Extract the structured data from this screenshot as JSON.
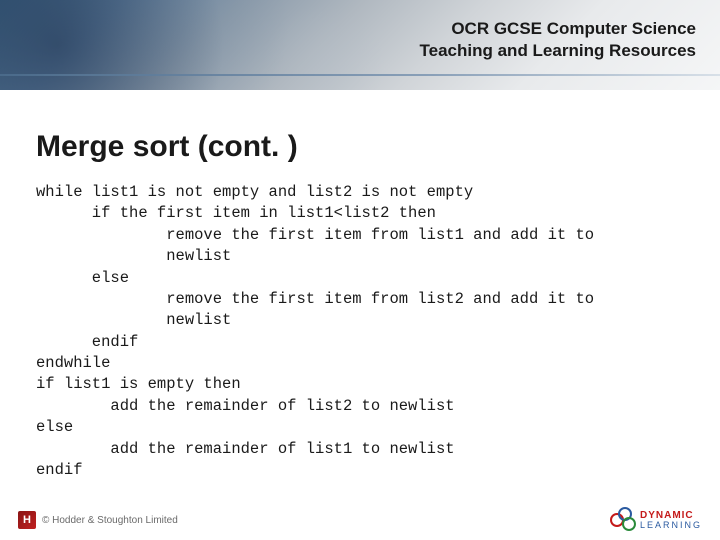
{
  "header": {
    "line1": "OCR GCSE Computer Science",
    "line2": "Teaching and Learning Resources"
  },
  "title": "Merge sort (cont. )",
  "code_lines": [
    "while list1 is not empty and list2 is not empty",
    "      if the first item in list1<list2 then",
    "              remove the first item from list1 and add it to",
    "              newlist",
    "      else",
    "              remove the first item from list2 and add it to",
    "              newlist",
    "      endif",
    "endwhile",
    "if list1 is empty then",
    "        add the remainder of list2 to newlist",
    "else",
    "        add the remainder of list1 to newlist",
    "endif"
  ],
  "footer": {
    "copyright": "© Hodder & Stoughton Limited",
    "brand_top": "DYNAMIC",
    "brand_bottom": "LEARNING"
  }
}
